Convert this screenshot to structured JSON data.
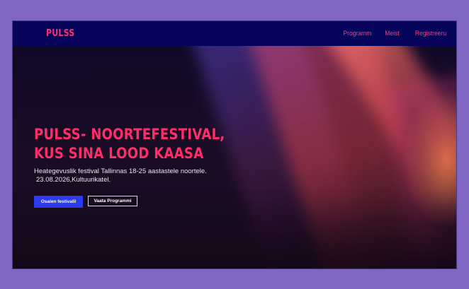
{
  "header": {
    "logo": "PULSS",
    "nav": [
      "Programm",
      "Meist",
      "Registreeru"
    ]
  },
  "hero": {
    "title": "PULSS- NOORTEFESTIVAL, KUS SINA LOOD KAASA",
    "description_line1": "Heategevuslik festival Tallinnas 18-25 aastastele noortele.",
    "description_line2": "23.08.2026,Kultuurikatel.",
    "primary_button": "Osalen festivalil",
    "secondary_button": "Vaata Programmi"
  },
  "colors": {
    "page_background": "#7f66c2",
    "nav_background": "#05045a",
    "accent": "#ff2e6a",
    "button_primary": "#2c3bf2"
  }
}
